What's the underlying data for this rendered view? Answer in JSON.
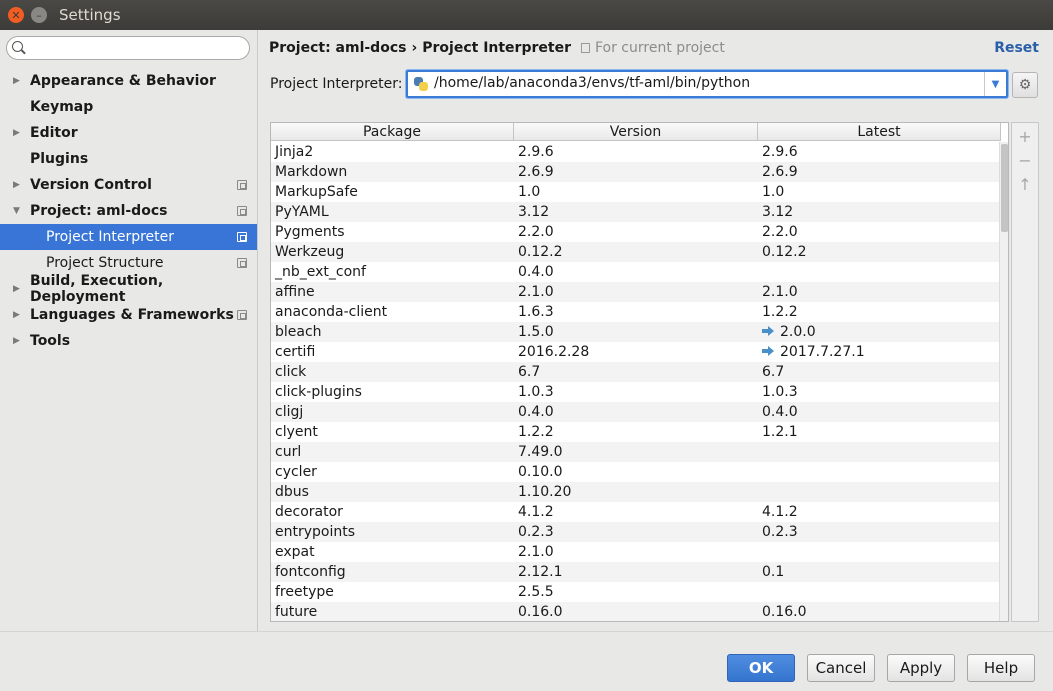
{
  "window": {
    "title": "Settings"
  },
  "search": {
    "placeholder": "",
    "value": ""
  },
  "sidebar": {
    "items": [
      {
        "label": "Appearance & Behavior",
        "arrow": "▶",
        "level": 0
      },
      {
        "label": "Keymap",
        "arrow": "",
        "level": 0
      },
      {
        "label": "Editor",
        "arrow": "▶",
        "level": 0
      },
      {
        "label": "Plugins",
        "arrow": "",
        "level": 0
      },
      {
        "label": "Version Control",
        "arrow": "▶",
        "level": 0
      },
      {
        "label": "Project: aml-docs",
        "arrow": "▼",
        "level": 0
      },
      {
        "label": "Project Interpreter",
        "arrow": "",
        "level": 1
      },
      {
        "label": "Project Structure",
        "arrow": "",
        "level": 1
      },
      {
        "label": "Build, Execution, Deployment",
        "arrow": "▶",
        "level": 0
      },
      {
        "label": "Languages & Frameworks",
        "arrow": "▶",
        "level": 0
      },
      {
        "label": "Tools",
        "arrow": "▶",
        "level": 0
      }
    ]
  },
  "main": {
    "breadcrumb": {
      "project": "Project: aml-docs",
      "separator": "›",
      "page": "Project Interpreter"
    },
    "scope_hint": "For current project",
    "reset_label": "Reset",
    "interpreter_label": "Project Interpreter:",
    "interpreter_value": "/home/lab/anaconda3/envs/tf-aml/bin/python",
    "table": {
      "headers": [
        "Package",
        "Version",
        "Latest"
      ],
      "rows": [
        {
          "package": "Jinja2",
          "version": "2.9.6",
          "latest": "2.9.6",
          "upgrade": false
        },
        {
          "package": "Markdown",
          "version": "2.6.9",
          "latest": "2.6.9",
          "upgrade": false
        },
        {
          "package": "MarkupSafe",
          "version": "1.0",
          "latest": "1.0",
          "upgrade": false
        },
        {
          "package": "PyYAML",
          "version": "3.12",
          "latest": "3.12",
          "upgrade": false
        },
        {
          "package": "Pygments",
          "version": "2.2.0",
          "latest": "2.2.0",
          "upgrade": false
        },
        {
          "package": "Werkzeug",
          "version": "0.12.2",
          "latest": "0.12.2",
          "upgrade": false
        },
        {
          "package": "_nb_ext_conf",
          "version": "0.4.0",
          "latest": "",
          "upgrade": false
        },
        {
          "package": "affine",
          "version": "2.1.0",
          "latest": "2.1.0",
          "upgrade": false
        },
        {
          "package": "anaconda-client",
          "version": "1.6.3",
          "latest": "1.2.2",
          "upgrade": false
        },
        {
          "package": "bleach",
          "version": "1.5.0",
          "latest": "2.0.0",
          "upgrade": true
        },
        {
          "package": "certifi",
          "version": "2016.2.28",
          "latest": "2017.7.27.1",
          "upgrade": true
        },
        {
          "package": "click",
          "version": "6.7",
          "latest": "6.7",
          "upgrade": false
        },
        {
          "package": "click-plugins",
          "version": "1.0.3",
          "latest": "1.0.3",
          "upgrade": false
        },
        {
          "package": "cligj",
          "version": "0.4.0",
          "latest": "0.4.0",
          "upgrade": false
        },
        {
          "package": "clyent",
          "version": "1.2.2",
          "latest": "1.2.1",
          "upgrade": false
        },
        {
          "package": "curl",
          "version": "7.49.0",
          "latest": "",
          "upgrade": false
        },
        {
          "package": "cycler",
          "version": "0.10.0",
          "latest": "",
          "upgrade": false
        },
        {
          "package": "dbus",
          "version": "1.10.20",
          "latest": "",
          "upgrade": false
        },
        {
          "package": "decorator",
          "version": "4.1.2",
          "latest": "4.1.2",
          "upgrade": false
        },
        {
          "package": "entrypoints",
          "version": "0.2.3",
          "latest": "0.2.3",
          "upgrade": false
        },
        {
          "package": "expat",
          "version": "2.1.0",
          "latest": "",
          "upgrade": false
        },
        {
          "package": "fontconfig",
          "version": "2.12.1",
          "latest": "0.1",
          "upgrade": false
        },
        {
          "package": "freetype",
          "version": "2.5.5",
          "latest": "",
          "upgrade": false
        },
        {
          "package": "future",
          "version": "0.16.0",
          "latest": "0.16.0",
          "upgrade": false
        }
      ]
    },
    "tools": {
      "add": "+",
      "remove": "−",
      "upgrade": "↑"
    }
  },
  "buttons": {
    "ok": "OK",
    "cancel": "Cancel",
    "apply": "Apply",
    "help": "Help"
  },
  "colors": {
    "accent": "#3875d7",
    "upgrade_arrow": "#4a90c8",
    "reset_link": "#2a5ea8"
  }
}
